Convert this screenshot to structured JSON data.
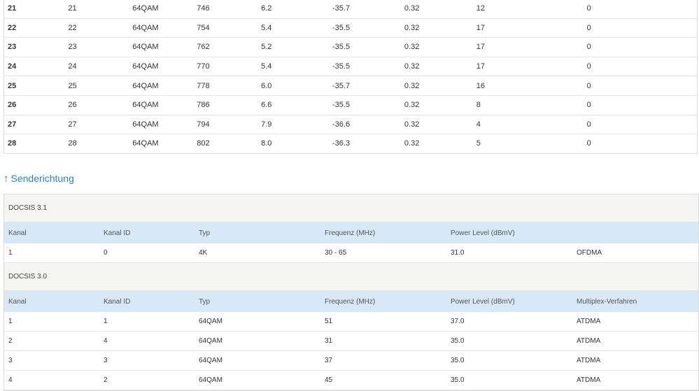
{
  "downstream": {
    "rows": [
      [
        "21",
        "21",
        "64QAM",
        "746",
        "6.2",
        "-35.7",
        "0.32",
        "12",
        "0"
      ],
      [
        "22",
        "22",
        "64QAM",
        "754",
        "5.4",
        "-35.5",
        "0.32",
        "17",
        "0"
      ],
      [
        "23",
        "23",
        "64QAM",
        "762",
        "5.2",
        "-35.5",
        "0.32",
        "17",
        "0"
      ],
      [
        "24",
        "24",
        "64QAM",
        "770",
        "5.4",
        "-35.5",
        "0.32",
        "17",
        "0"
      ],
      [
        "25",
        "25",
        "64QAM",
        "778",
        "6.0",
        "-35.7",
        "0.32",
        "16",
        "0"
      ],
      [
        "26",
        "26",
        "64QAM",
        "786",
        "6.6",
        "-35.5",
        "0.32",
        "8",
        "0"
      ],
      [
        "27",
        "27",
        "64QAM",
        "794",
        "7.9",
        "-36.6",
        "0.32",
        "4",
        "0"
      ],
      [
        "28",
        "28",
        "64QAM",
        "802",
        "8.0",
        "-36.3",
        "0.32",
        "5",
        "0"
      ]
    ]
  },
  "upstream": {
    "title": "Senderichtung",
    "arrow_icon": "arrow-up-icon",
    "accent_color": "#2a7fc9",
    "docsis31": {
      "label": "DOCSIS 3.1",
      "headers": [
        "Kanal",
        "Kanal ID",
        "Typ",
        "Frequenz (MHz)",
        "Power Level (dBmV)",
        ""
      ],
      "rows": [
        [
          "1",
          "0",
          "4K",
          "30 - 65",
          "31.0",
          "OFDMA"
        ]
      ]
    },
    "docsis30": {
      "label": "DOCSIS 3.0",
      "headers": [
        "Kanal",
        "Kanal ID",
        "Typ",
        "Frequenz (MHz)",
        "Power Level (dBmV)",
        "Multiplex-Verfahren"
      ],
      "rows": [
        [
          "1",
          "1",
          "64QAM",
          "51",
          "37.0",
          "ATDMA"
        ],
        [
          "2",
          "4",
          "64QAM",
          "31",
          "35.0",
          "ATDMA"
        ],
        [
          "3",
          "3",
          "64QAM",
          "37",
          "35.0",
          "ATDMA"
        ],
        [
          "4",
          "2",
          "64QAM",
          "45",
          "35.0",
          "ATDMA"
        ]
      ]
    }
  }
}
